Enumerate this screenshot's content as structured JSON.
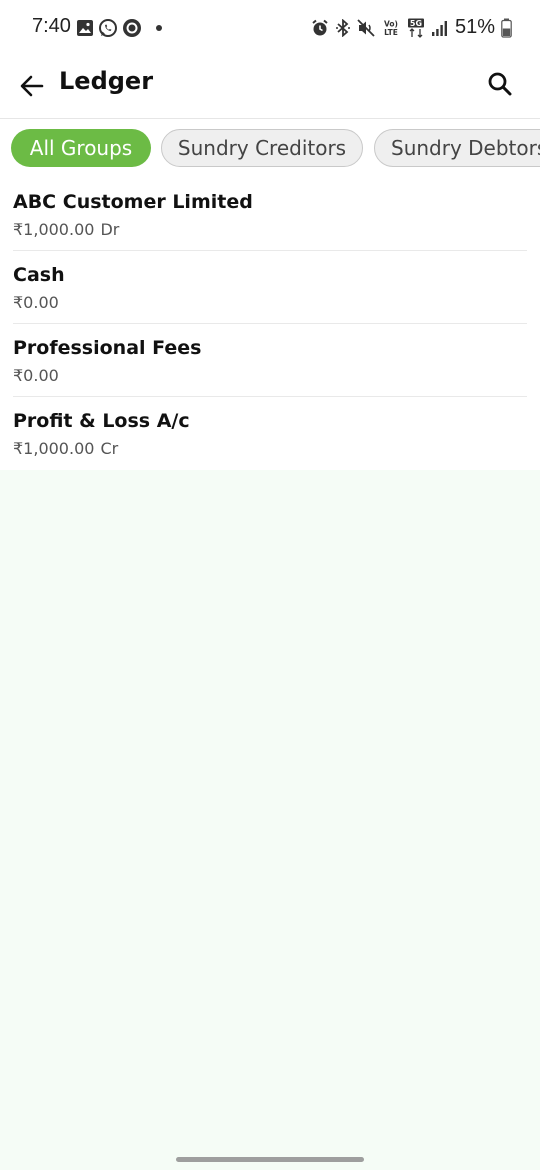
{
  "status_bar": {
    "time": "7:40",
    "battery": "51%",
    "left_icons": [
      "gallery-icon",
      "whatsapp-icon",
      "record-icon",
      "dot-icon"
    ],
    "right_icons": [
      "alarm-icon",
      "bluetooth-icon",
      "mute-icon",
      "volte-icon",
      "5g-icon",
      "signal-icon",
      "battery-icon"
    ]
  },
  "header": {
    "title": "Ledger"
  },
  "filters": [
    {
      "label": "All Groups",
      "active": true
    },
    {
      "label": "Sundry Creditors",
      "active": false
    },
    {
      "label": "Sundry Debtors",
      "active": false
    }
  ],
  "ledgers": [
    {
      "name": "ABC Customer Limited",
      "amount": "₹1,000.00",
      "suffix": "Dr"
    },
    {
      "name": "Cash",
      "amount": "₹0.00",
      "suffix": ""
    },
    {
      "name": "Professional Fees",
      "amount": "₹0.00",
      "suffix": ""
    },
    {
      "name": "Profit & Loss A/c",
      "amount": "₹1,000.00",
      "suffix": "Cr"
    }
  ],
  "colors": {
    "accent": "#6cbb45",
    "background": "#f5fcf6"
  }
}
